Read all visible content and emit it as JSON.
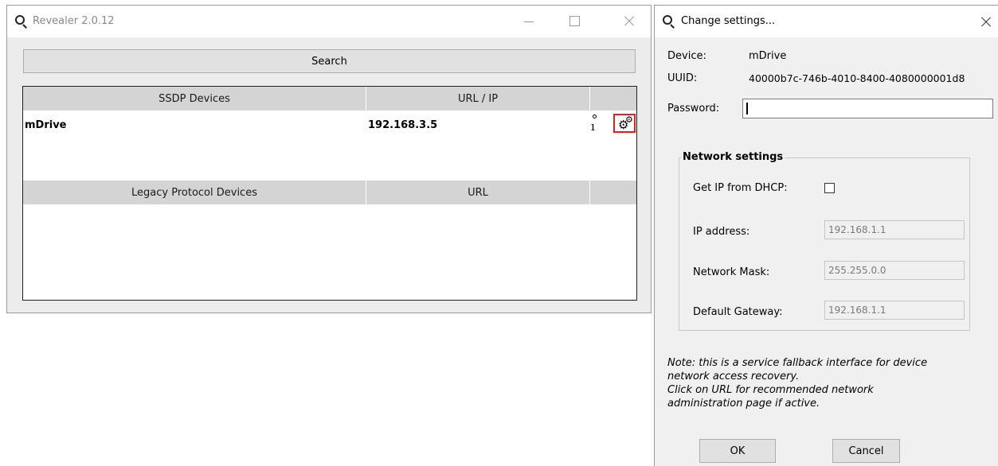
{
  "revealer": {
    "title": "Revealer 2.0.12",
    "search_label": "Search",
    "ssdp_headers": [
      "SSDP Devices",
      "URL / IP",
      ""
    ],
    "legacy_headers": [
      "Legacy Protocol Devices",
      "URL",
      ""
    ],
    "rows": [
      {
        "name": "mDrive",
        "ip": "192.168.3.5"
      }
    ],
    "icons": [
      "search-icon",
      "info-icon",
      "settings-gear-icon",
      "minimize-icon",
      "maximize-icon",
      "close-icon"
    ]
  },
  "dialog": {
    "title": "Change settings...",
    "device_label": "Device:",
    "device_value": "mDrive",
    "uuid_label": "UUID:",
    "uuid_value": "40000b7c-746b-4010-8400-4080000001d8",
    "password_label": "Password:",
    "password_value": "",
    "network_group_title": "Network settings",
    "dhcp_label": "Get IP from DHCP:",
    "dhcp_checked": false,
    "ip_label": "IP address:",
    "ip_value": "192.168.1.1",
    "mask_label": "Network Mask:",
    "mask_value": "255.255.0.0",
    "gateway_label": "Default Gateway:",
    "gateway_value": "192.168.1.1",
    "note_line1": "Note: this is a service fallback interface for device",
    "note_line2": "network access recovery.",
    "note_line3": "Click on URL for recommended network",
    "note_line4": "administration page if active.",
    "ok_label": "OK",
    "cancel_label": "Cancel"
  },
  "colors": {
    "highlight_border": "#e02020",
    "header_bg": "#d4d4d4",
    "window_bg": "#ececec"
  }
}
